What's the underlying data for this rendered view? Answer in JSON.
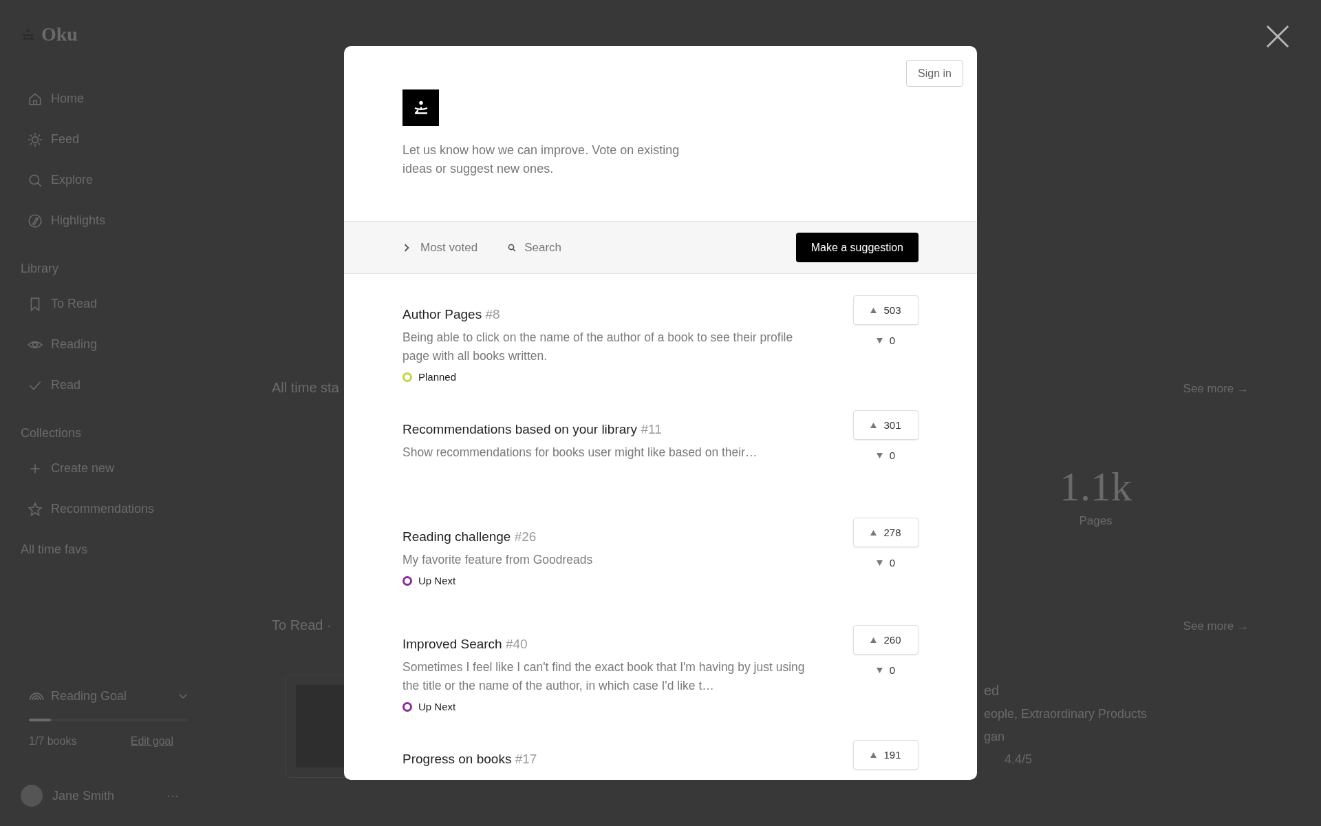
{
  "app": {
    "name": "Oku"
  },
  "sidebar": {
    "nav": [
      {
        "label": "Home"
      },
      {
        "label": "Feed"
      },
      {
        "label": "Explore"
      },
      {
        "label": "Highlights"
      }
    ],
    "sections": [
      {
        "heading": "Library",
        "items": [
          {
            "label": "To Read"
          },
          {
            "label": "Reading"
          },
          {
            "label": "Read"
          }
        ]
      },
      {
        "heading": "Collections",
        "items": [
          {
            "label": "Create new"
          },
          {
            "label": "Recommendations"
          },
          {
            "label": "All time favs"
          }
        ]
      }
    ],
    "reading_goal": {
      "label": "Reading Goal",
      "level": 0.14,
      "count": "1/7 books",
      "edit": "Edit goal"
    },
    "user": {
      "name": "Jane Smith",
      "more": "···"
    }
  },
  "main": {
    "stats": {
      "heading": "All time sta",
      "link": "See more →",
      "value": "1.1k",
      "caption": "Pages"
    },
    "to_read": {
      "heading": "To Read ·",
      "link": "See more →"
    },
    "book_texts": [
      "ed",
      "eople, Extraordinary Products",
      "gan",
      "4.4/5"
    ]
  },
  "feedback": {
    "sign_in": "Sign in",
    "intro": "Let us know how we can improve. Vote on existing ideas or suggest new ones.",
    "sort": "Most voted",
    "search": {
      "placeholder": "Search"
    },
    "suggest_button": "Make a suggestion",
    "suggestions": [
      {
        "title": "Author Pages",
        "number": "#8",
        "description": "Being able to click on the name of the author of a book to see their profile page with all books written.",
        "status": {
          "label": "Planned",
          "color": "#c2d63f"
        },
        "upvotes": "503",
        "downvotes": "0"
      },
      {
        "title": "Recommendations based on your library",
        "number": "#11",
        "description": "Show recommendations for books user might like based on their…",
        "upvotes": "301",
        "downvotes": "0"
      },
      {
        "title": "Reading challenge",
        "number": "#26",
        "description": "My favorite feature from Goodreads",
        "status": {
          "label": "Up Next",
          "color": "#8b2a9e"
        },
        "upvotes": "278",
        "downvotes": "0"
      },
      {
        "title": "Improved Search",
        "number": "#40",
        "description": "Sometimes I feel like I can't find the exact book that I'm having by just using the title or the name of the author, in which case I'd like t…",
        "status": {
          "label": "Up Next",
          "color": "#8b2a9e"
        },
        "upvotes": "260",
        "downvotes": "0"
      },
      {
        "title": "Progress on books",
        "number": "#17",
        "upvotes": "191"
      }
    ]
  }
}
